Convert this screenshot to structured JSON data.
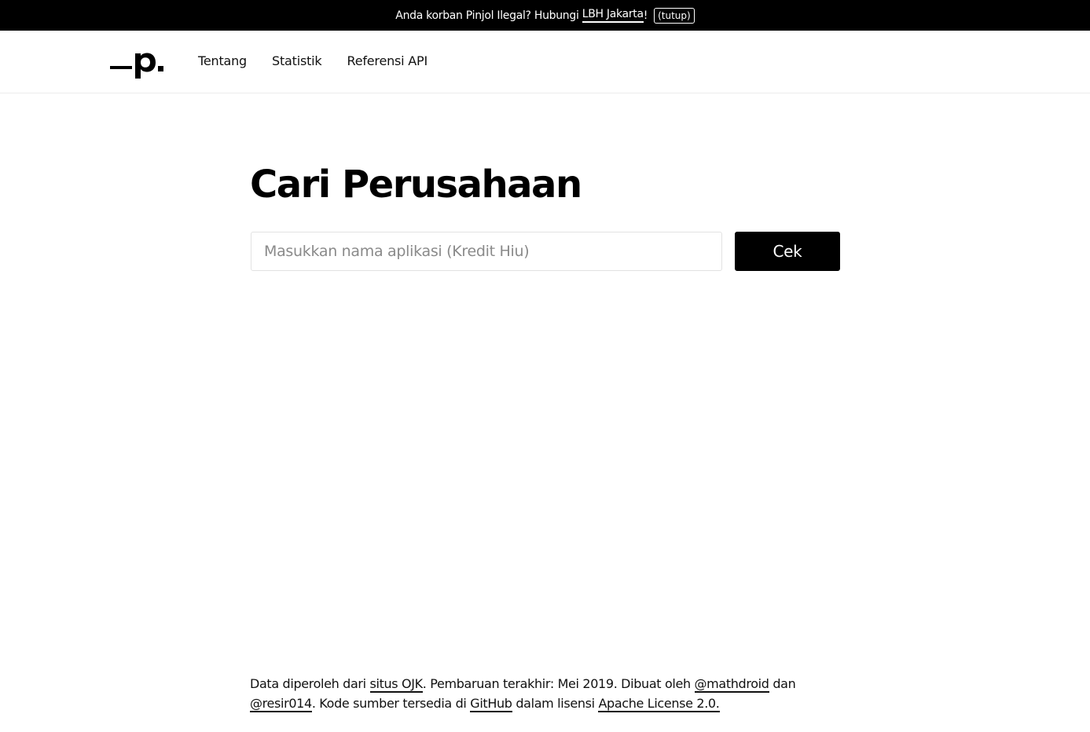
{
  "banner": {
    "text": "Anda korban Pinjol Ilegal? Hubungi ",
    "link": "LBH Jakarta",
    "suffix": "!",
    "close": "(tutup)"
  },
  "nav": {
    "logo_text": "_p.",
    "items": [
      "Tentang",
      "Statistik",
      "Referensi API"
    ]
  },
  "main": {
    "title": "Cari Perusahaan",
    "search_placeholder": "Masukkan nama aplikasi (Kredit Hiu)",
    "search_value": "",
    "button": "Cek"
  },
  "footer": {
    "t1": "Data diperoleh dari ",
    "l1": "situs OJK",
    "t2": ". Pembaruan terakhir: Mei 2019. Dibuat oleh ",
    "l2": "@mathdroid",
    "t3": " dan ",
    "l3": "@resir014",
    "t4": ". Kode sumber tersedia di ",
    "l4": "GitHub",
    "t5": " dalam lisensi ",
    "l5": "Apache License 2.0."
  }
}
